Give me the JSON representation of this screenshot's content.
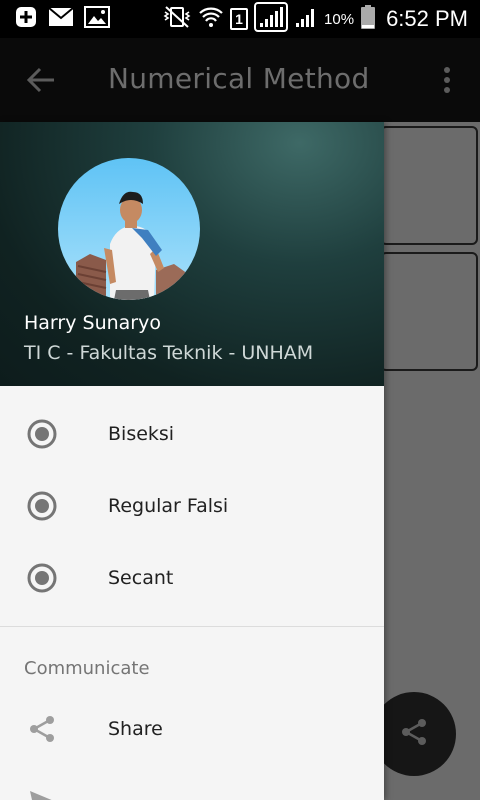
{
  "status_bar": {
    "left_icons": [
      "add-notification-icon",
      "mail-icon",
      "image-icon"
    ],
    "right_icons": [
      "vibrate-icon",
      "wifi-icon",
      "sim-icon",
      "signal-icon",
      "signal-icon",
      "battery-icon"
    ],
    "sim_number": "1",
    "battery_percent": "10%",
    "time": "6:52 PM"
  },
  "toolbar": {
    "title": "Numerical Method",
    "back_icon": "arrow-back-icon",
    "menu_icon": "more-vert-icon"
  },
  "drawer": {
    "user": {
      "name": "Harry Sunaryo",
      "subtitle": "TI C - Fakultas Teknik - UNHAM"
    },
    "items": [
      {
        "label": "Biseksi",
        "icon": "radio-button-checked-icon"
      },
      {
        "label": "Regular Falsi",
        "icon": "radio-button-checked-icon"
      },
      {
        "label": "Secant",
        "icon": "radio-button-checked-icon"
      }
    ],
    "section": {
      "title": "Communicate",
      "items": [
        {
          "label": "Share",
          "icon": "share-icon"
        },
        {
          "label": "",
          "icon": "send-icon"
        }
      ]
    }
  },
  "fab": {
    "icon": "share-icon"
  },
  "colors": {
    "drawer_header_dark": "#0d1c1c",
    "drawer_header_light": "#3e6966",
    "toolbar_title_dimmed": "#6d6d6d",
    "drawer_bg": "#f5f5f5",
    "scrim_bg": "#6b6b6b"
  }
}
